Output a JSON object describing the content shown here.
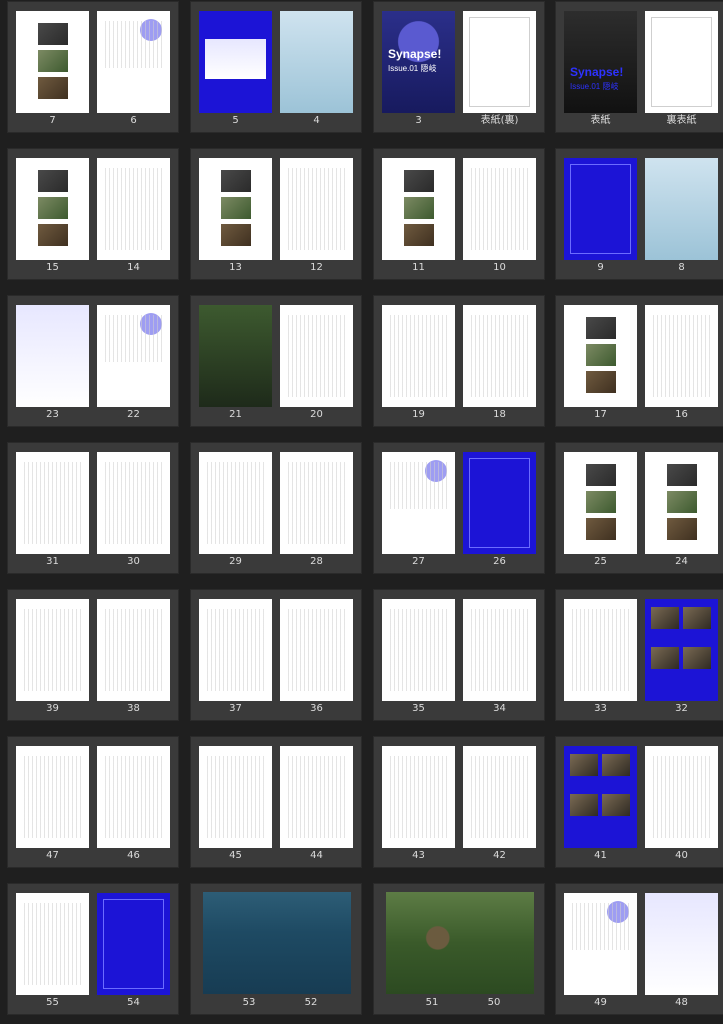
{
  "rows": [
    {
      "spreads": [
        {
          "left": "7",
          "right": "6"
        },
        {
          "left": "5",
          "right": "4"
        },
        {
          "left": "3",
          "right": "表紙(裏)"
        },
        {
          "left": "表紙",
          "right": "裏表紙"
        }
      ]
    },
    {
      "spreads": [
        {
          "left": "15",
          "right": "14"
        },
        {
          "left": "13",
          "right": "12"
        },
        {
          "left": "11",
          "right": "10"
        },
        {
          "left": "9",
          "right": "8"
        }
      ]
    },
    {
      "spreads": [
        {
          "left": "23",
          "right": "22"
        },
        {
          "left": "21",
          "right": "20"
        },
        {
          "left": "19",
          "right": "18"
        },
        {
          "left": "17",
          "right": "16"
        }
      ]
    },
    {
      "spreads": [
        {
          "left": "31",
          "right": "30"
        },
        {
          "left": "29",
          "right": "28"
        },
        {
          "left": "27",
          "right": "26"
        },
        {
          "left": "25",
          "right": "24"
        }
      ]
    },
    {
      "spreads": [
        {
          "left": "39",
          "right": "38"
        },
        {
          "left": "37",
          "right": "36"
        },
        {
          "left": "35",
          "right": "34"
        },
        {
          "left": "33",
          "right": "32"
        }
      ]
    },
    {
      "spreads": [
        {
          "left": "47",
          "right": "46"
        },
        {
          "left": "45",
          "right": "44"
        },
        {
          "left": "43",
          "right": "42"
        },
        {
          "left": "41",
          "right": "40"
        }
      ]
    },
    {
      "spreads": [
        {
          "left": "55",
          "right": "54"
        },
        {
          "left": "53",
          "right": "52"
        },
        {
          "left": "51",
          "right": "50"
        },
        {
          "left": "49",
          "right": "48"
        }
      ]
    }
  ],
  "cover": {
    "title": "Synapse!",
    "issue": "Issue.01 隠岐"
  },
  "colors": {
    "background": "#1f1f1f",
    "panel": "#3a3a3a",
    "accent_blue": "#1c14d6",
    "label": "#dcdcdc"
  }
}
